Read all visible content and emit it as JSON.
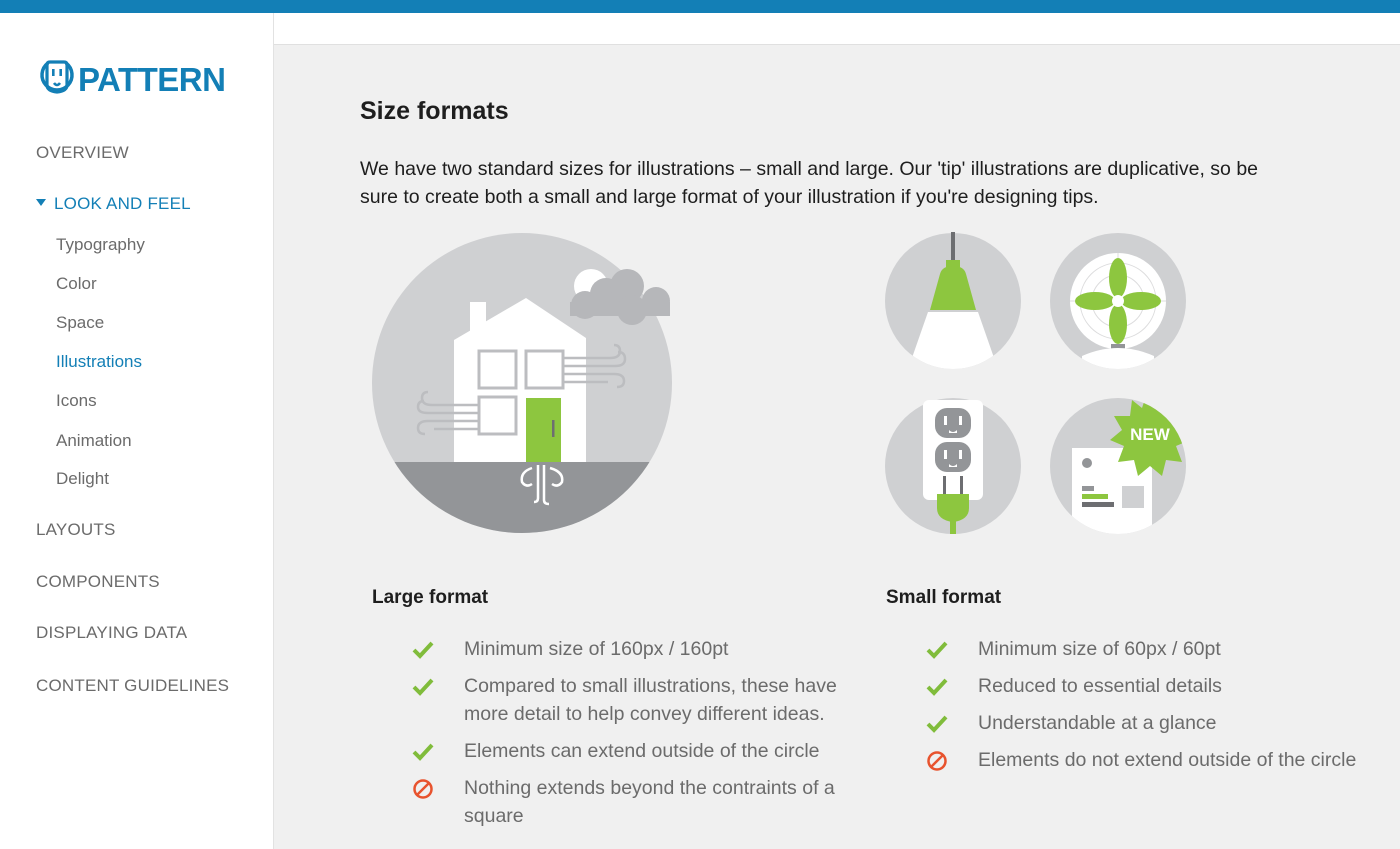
{
  "brand": {
    "name": "PATTERN",
    "color": "#137fb6",
    "logo_icon": "outlet-face-icon"
  },
  "nav": {
    "items": [
      {
        "label": "OVERVIEW",
        "active": false
      },
      {
        "label": "LOOK AND FEEL",
        "active": true
      },
      {
        "label": "LAYOUTS",
        "active": false
      },
      {
        "label": "COMPONENTS",
        "active": false
      },
      {
        "label": "DISPLAYING DATA",
        "active": false
      },
      {
        "label": "CONTENT GUIDELINES",
        "active": false
      }
    ],
    "sub_items": [
      {
        "label": "Typography",
        "current": false
      },
      {
        "label": "Color",
        "current": false
      },
      {
        "label": "Space",
        "current": false
      },
      {
        "label": "Illustrations",
        "current": true
      },
      {
        "label": "Icons",
        "current": false
      },
      {
        "label": "Animation",
        "current": false
      },
      {
        "label": "Delight",
        "current": false
      }
    ]
  },
  "page": {
    "title": "Size formats",
    "intro": "We have two standard sizes for illustrations – small and large. Our 'tip' illustrations are duplicative, so be sure to create both a small and large format of your illustration if you're designing tips."
  },
  "illustrations": {
    "large": {
      "icon": "house-illustration-icon"
    },
    "small": [
      {
        "icon": "lamp-illustration-icon"
      },
      {
        "icon": "fan-illustration-icon"
      },
      {
        "icon": "outlet-plug-illustration-icon"
      },
      {
        "icon": "new-report-illustration-icon",
        "badge": "NEW"
      }
    ]
  },
  "large_format": {
    "title": "Large format",
    "items": [
      {
        "text": "Minimum size of 160px / 160pt",
        "kind": "check"
      },
      {
        "text": "Compared to small illustrations, these have more detail to help convey different ideas.",
        "kind": "check"
      },
      {
        "text": "Elements can extend outside of the circle",
        "kind": "check"
      },
      {
        "text": "Nothing extends beyond the contraints of a square",
        "kind": "prohibited"
      }
    ]
  },
  "small_format": {
    "title": "Small format",
    "items": [
      {
        "text": "Minimum size of 60px / 60pt",
        "kind": "check"
      },
      {
        "text": "Reduced to essential details",
        "kind": "check"
      },
      {
        "text": "Understandable at a glance",
        "kind": "check"
      },
      {
        "text": "Elements do not extend outside of the circle",
        "kind": "prohibited"
      }
    ]
  },
  "colors": {
    "accent": "#137fb6",
    "check": "#80bc3b",
    "prohibited": "#e8532e",
    "illus_green": "#8dc63f",
    "illus_gray": "#cfd0d2"
  }
}
